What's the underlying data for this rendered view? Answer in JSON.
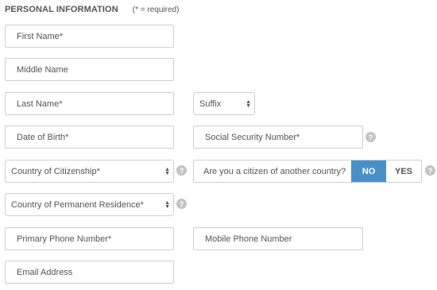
{
  "section": {
    "title": "PERSONAL INFORMATION",
    "required_note": "(* = required)"
  },
  "fields": {
    "first_name": "First Name*",
    "middle_name": "Middle Name",
    "last_name": "Last Name*",
    "dob": "Date of Birth*",
    "ssn": "Social Security Number*",
    "primary_phone": "Primary Phone Number*",
    "mobile_phone": "Mobile Phone Number",
    "email": "Email Address"
  },
  "selects": {
    "suffix": "Suffix",
    "citizenship": "Country of Citizenship*",
    "residence": "Country of Permanent Residence*"
  },
  "citizen_question": {
    "text": "Are you a citizen of another country?",
    "no_label": "NO",
    "yes_label": "YES",
    "selected": "NO"
  },
  "help_glyph": "?",
  "colors": {
    "selected_toggle": "#4a90c8",
    "help_icon": "#c4c4c4",
    "border": "#cfcfcf"
  }
}
